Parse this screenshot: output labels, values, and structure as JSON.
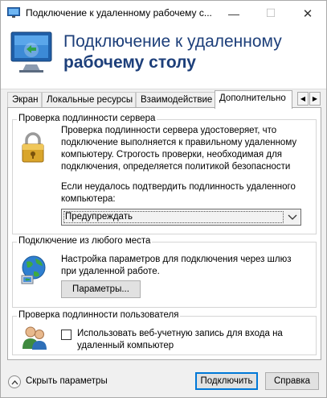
{
  "window": {
    "title": "Подключение к удаленному рабочему с...",
    "icon": "remote-desktop-icon",
    "controls": {
      "minimize": "—",
      "maximize": "☐",
      "close": "✕"
    }
  },
  "banner": {
    "line1": "Подключение к удаленному",
    "line2": "рабочему столу",
    "logo": "remote-desktop-logo"
  },
  "tabs": [
    {
      "label": "Экран"
    },
    {
      "label": "Локальные ресурсы"
    },
    {
      "label": "Взаимодействие"
    },
    {
      "label": "Дополнительно"
    }
  ],
  "tab_scroll": {
    "left": "◀",
    "right": "▶"
  },
  "server_auth": {
    "title": "Проверка подлинности сервера",
    "icon": "lock-icon",
    "description": "Проверка подлинности сервера удостоверяет, что подключение выполняется к правильному удаленному компьютеру. Строгость проверки, необходимая для подключения, определяется политикой безопасности",
    "fail_prompt": "Если неудалось подтвердить подлинность удаленного компьютера:",
    "selected_option": "Предупреждать"
  },
  "connect_anywhere": {
    "title": "Подключение из любого места",
    "icon": "globe-network-icon",
    "description": "Настройка параметров для подключения через шлюз при удаленной работе.",
    "settings_button": "Параметры..."
  },
  "user_auth": {
    "title": "Проверка подлинности пользователя",
    "icon": "users-icon",
    "checkbox_label": "Использовать веб-учетную запись для входа на удаленный компьютер",
    "checked": false
  },
  "footer": {
    "hide_options": "Скрыть параметры",
    "connect": "Подключить",
    "help": "Справка"
  },
  "colors": {
    "accent": "#0078d7",
    "banner_text": "#1d3f7a"
  }
}
